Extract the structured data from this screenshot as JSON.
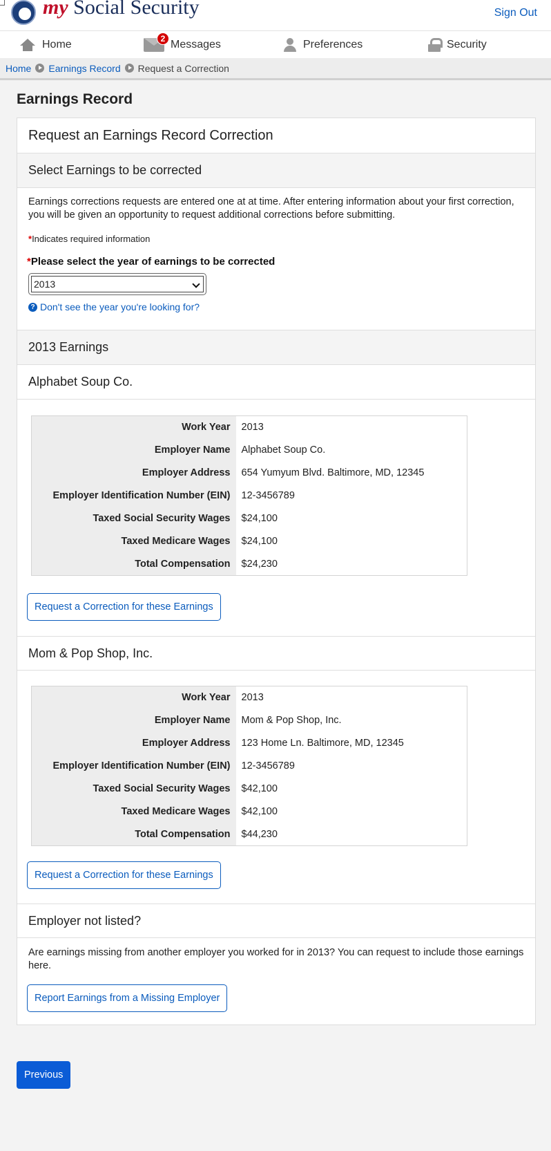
{
  "header": {
    "brand_my": "my",
    "brand_rest": " Social Security",
    "sign_out": "Sign Out"
  },
  "nav": {
    "home": "Home",
    "messages": "Messages",
    "messages_count": "2",
    "preferences": "Preferences",
    "security": "Security"
  },
  "breadcrumb": [
    "Home",
    "Earnings Record",
    "Request a Correction"
  ],
  "page_title": "Earnings Record",
  "card": {
    "title": "Request an Earnings Record Correction",
    "select_section_title": "Select Earnings to be corrected",
    "intro": "Earnings corrections requests are entered one at at time. After entering information about your first correction, you will be given an opportunity to request additional corrections before submitting.",
    "required_note_star": "*",
    "required_note": "Indicates required information",
    "year_label": "Please select the year of earnings to be corrected",
    "year_selected": "2013",
    "help_link": "Don't see the year you're looking for?",
    "earnings_title": "2013 Earnings",
    "row_labels": [
      "Work Year",
      "Employer Name",
      "Employer Address",
      "Employer Identification Number (EIN)",
      "Taxed Social Security Wages",
      "Taxed Medicare Wages",
      "Total Compensation"
    ],
    "employers": [
      {
        "name": "Alphabet Soup Co.",
        "values": [
          "2013",
          "Alphabet Soup Co.",
          "654 Yumyum Blvd. Baltimore, MD, 12345",
          "12-3456789",
          "$24,100",
          "$24,100",
          "$24,230"
        ],
        "button": "Request a Correction for these Earnings"
      },
      {
        "name": "Mom & Pop Shop, Inc.",
        "values": [
          "2013",
          "Mom & Pop Shop, Inc.",
          "123 Home Ln. Baltimore, MD, 12345",
          "12-3456789",
          "$42,100",
          "$42,100",
          "$44,230"
        ],
        "button": "Request a Correction for these Earnings"
      }
    ],
    "missing_title": "Employer not listed?",
    "missing_text": "Are earnings missing from another employer you worked for in 2013? You can request to include those earnings here.",
    "missing_button": "Report Earnings from a Missing Employer"
  },
  "previous_button": "Previous"
}
